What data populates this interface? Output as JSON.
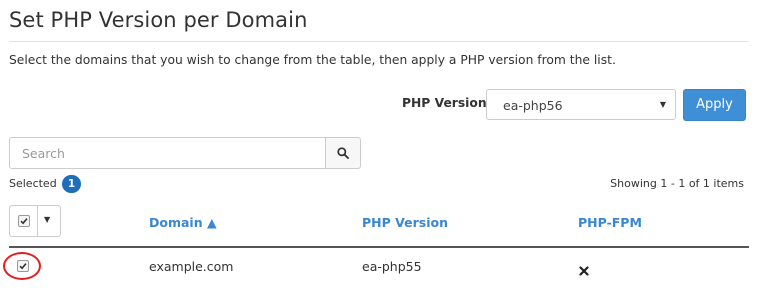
{
  "page": {
    "title": "Set PHP Version per Domain",
    "description": "Select the domains that you wish to change from the table, then apply a PHP version from the list."
  },
  "php_version_control": {
    "label": "PHP Version",
    "selected_value": "ea-php56",
    "apply_label": "Apply"
  },
  "search": {
    "placeholder": "Search",
    "value": ""
  },
  "selection": {
    "label": "Selected",
    "count": "1"
  },
  "pagination": {
    "prefix": "Showing",
    "range": "1 - 1 of 1 items"
  },
  "table": {
    "columns": [
      {
        "label": "Domain ▲",
        "sortable": true,
        "sort": "ascending"
      },
      {
        "label": "PHP Version",
        "sortable": true
      },
      {
        "label": "PHP-FPM",
        "sortable": true
      }
    ],
    "rows": [
      {
        "checked": true,
        "domain": "example.com",
        "php_version": "ea-php55",
        "php_fpm": "disabled-x-icon"
      }
    ]
  },
  "colors": {
    "accent": "#3a87d1",
    "apply_button": "#3f8fd6",
    "badge": "#1f6fb8",
    "annotation_circle": "#e02020"
  }
}
